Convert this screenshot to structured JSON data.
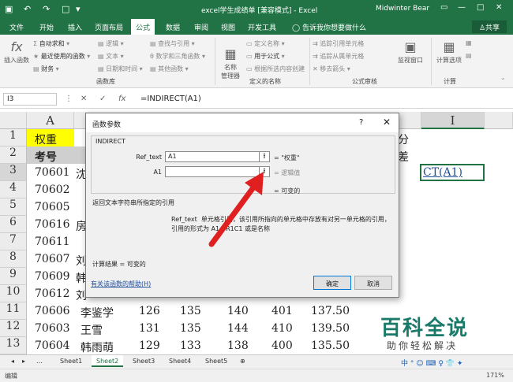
{
  "titlebar": {
    "title": "excel学生成绩单 [兼容模式] - Excel",
    "user": "Midwinter Bear"
  },
  "menu": {
    "tabs": [
      "文件",
      "开始",
      "插入",
      "页面布局",
      "公式",
      "数据",
      "审阅",
      "视图",
      "开发工具"
    ],
    "active": "公式",
    "tellme": "告诉我你想要做什么",
    "share": "共享"
  },
  "ribbon": {
    "insert_function": "插入函数",
    "autosum": "自动求和",
    "recent": "最近使用的函数",
    "finance": "财务",
    "logic": "逻辑",
    "text": "文本",
    "datetime": "日期和时间",
    "lookup": "查找与引用",
    "math": "数学和三角函数",
    "other": "其他函数",
    "lib_label": "函数库",
    "name_mgr": "名称\n管理器",
    "define_name": "定义名称",
    "use_in_formula": "用于公式",
    "create_from_sel": "根据所选内容创建",
    "names_label": "定义的名称",
    "trace_prec": "追踪引用单元格",
    "trace_dep": "追踪从属单元格",
    "remove_arrows": "移去箭头",
    "audit_label": "公式审核",
    "watch": "监视窗口",
    "calc_options": "计算选项",
    "calc_label": "计算"
  },
  "formulabar": {
    "namebox": "I3",
    "formula": "=INDIRECT(A1)"
  },
  "columns": [
    "A",
    "I"
  ],
  "rows": [
    "1",
    "2",
    "3",
    "4",
    "5",
    "6",
    "7",
    "8",
    "9",
    "10",
    "11",
    "12",
    "13"
  ],
  "cells": {
    "a1": "权重",
    "a2": "考号",
    "ids": [
      "70601",
      "70602",
      "70605",
      "70616",
      "70611",
      "70607",
      "70609",
      "70612",
      "70606",
      "70603",
      "70604"
    ],
    "b_partial": [
      "沈",
      "",
      "",
      "房",
      "",
      "刘",
      "韩",
      "刘"
    ],
    "h1": "分",
    "h2": "差",
    "i3": "CT(A1)",
    "rows_tail": [
      {
        "name": "李鉴学",
        "v": [
          "126",
          "135",
          "140",
          "401",
          "137.50"
        ]
      },
      {
        "name": "王雪",
        "v": [
          "131",
          "135",
          "144",
          "410",
          "139.50"
        ]
      },
      {
        "name": "韩雨萌",
        "v": [
          "129",
          "133",
          "138",
          "400",
          "135.50"
        ]
      }
    ]
  },
  "dialog": {
    "title": "函数参数",
    "help_q": "?",
    "close": "✕",
    "fn_name": "INDIRECT",
    "arg1_label": "Ref_text",
    "arg1_value": "A1",
    "arg1_result": "= \"权重\"",
    "arg2_label": "A1",
    "arg2_value": "",
    "arg2_result": "= 逻辑值",
    "fn_result": "= 可变的",
    "description": "返回文本字符串所指定的引用",
    "ref_help_label": "Ref_text",
    "ref_help": "单元格引用，该引用所指向的单元格中存放有对另一单元格的引用，引用的形式为 A1、R1C1 或是名称",
    "calc_result": "计算结果 =  可变的",
    "help_link": "有关该函数的帮助(H)",
    "ok": "确定",
    "cancel": "取消"
  },
  "sheets": {
    "tabs": [
      "Sheet1",
      "Sheet2",
      "Sheet3",
      "Sheet4",
      "Sheet5"
    ],
    "active": "Sheet2"
  },
  "status": {
    "mode": "编辑",
    "zoom": "171%"
  },
  "watermark": {
    "main": "百科全说",
    "sub": "助你轻松解决"
  },
  "ime": {
    "text": "中 ° ☺ ⌨ ♀ 👕 ✦"
  },
  "colors": {
    "excel_green": "#217346",
    "selected_cell_green": "#217346",
    "header_yellow": "#ffff00",
    "highlight_blue": "#1f4e9b"
  }
}
